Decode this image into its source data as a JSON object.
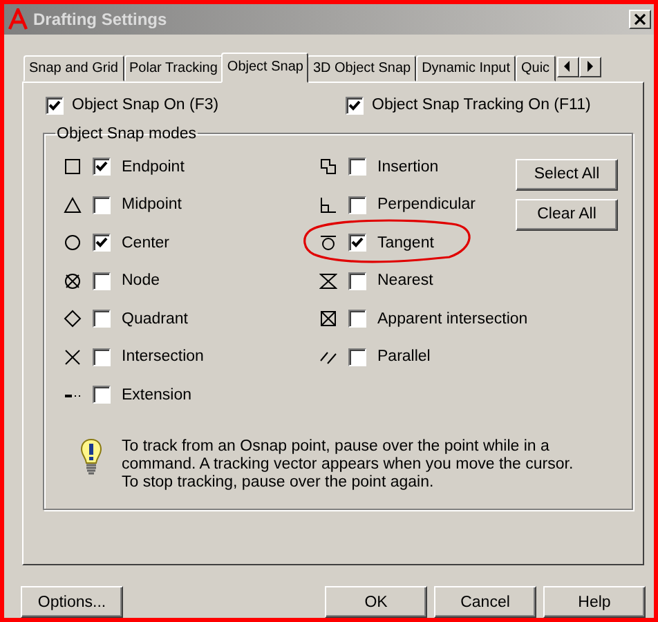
{
  "window": {
    "title": "Drafting Settings"
  },
  "tabs": [
    {
      "label": "Snap and Grid",
      "selected": false
    },
    {
      "label": "Polar Tracking",
      "selected": false
    },
    {
      "label": "Object Snap",
      "selected": true
    },
    {
      "label": "3D Object Snap",
      "selected": false
    },
    {
      "label": "Dynamic Input",
      "selected": false
    },
    {
      "label": "Quic",
      "selected": false
    }
  ],
  "toggles": [
    {
      "label": "Object Snap On (F3)",
      "checked": true
    },
    {
      "label": "Object Snap Tracking On (F11)",
      "checked": true
    }
  ],
  "modes_group": {
    "title": "Object Snap modes",
    "left": [
      {
        "label": "Endpoint",
        "checked": true
      },
      {
        "label": "Midpoint",
        "checked": false
      },
      {
        "label": "Center",
        "checked": true
      },
      {
        "label": "Node",
        "checked": false
      },
      {
        "label": "Quadrant",
        "checked": false
      },
      {
        "label": "Intersection",
        "checked": false
      },
      {
        "label": "Extension",
        "checked": false
      }
    ],
    "right": [
      {
        "label": "Insertion",
        "checked": false,
        "circled": false
      },
      {
        "label": "Perpendicular",
        "checked": false,
        "circled": false
      },
      {
        "label": "Tangent",
        "checked": true,
        "circled": true
      },
      {
        "label": "Nearest",
        "checked": false,
        "circled": false
      },
      {
        "label": "Apparent intersection",
        "checked": false,
        "circled": false
      },
      {
        "label": "Parallel",
        "checked": false,
        "circled": false
      }
    ],
    "buttons": [
      "Select All",
      "Clear All"
    ]
  },
  "hint": {
    "lines": [
      "To track from an Osnap point, pause over the point while in a",
      "command.  A tracking vector appears when you move the cursor.",
      "To stop tracking, pause over the point again."
    ]
  },
  "buttons": [
    "Options...",
    "OK",
    "Cancel",
    "Help"
  ]
}
